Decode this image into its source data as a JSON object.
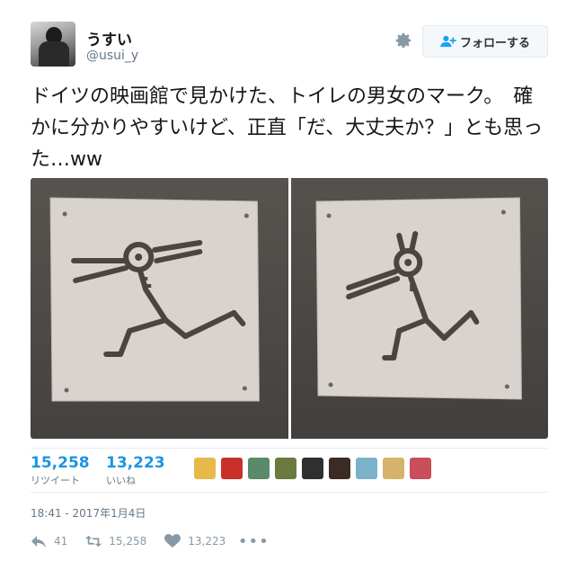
{
  "user": {
    "display_name": "うすい",
    "screen_name": "@usui_y"
  },
  "follow_button": {
    "label": "フォローする"
  },
  "tweet": {
    "text": "ドイツの映画館で見かけた、トイレの男女のマーク。　確かに分かりやすいけど、正直「だ、大丈夫か？」とも思った…ww"
  },
  "photos": [
    {
      "subject": "men's toilet sign"
    },
    {
      "subject": "women's toilet sign"
    }
  ],
  "stats": {
    "retweets": {
      "count": "15,258",
      "label": "リツイート"
    },
    "likes": {
      "count": "13,223",
      "label": "いいね"
    }
  },
  "likers": [
    {
      "color": "#e8b84a"
    },
    {
      "color": "#c8302a"
    },
    {
      "color": "#5a8a6a"
    },
    {
      "color": "#6b7a3f"
    },
    {
      "color": "#2f2f2f"
    },
    {
      "color": "#3a2b25"
    },
    {
      "color": "#7bb1c9"
    },
    {
      "color": "#d6b36a"
    },
    {
      "color": "#c94d5b"
    }
  ],
  "timestamp": "18:41 - 2017年1月4日",
  "actions": {
    "reply": {
      "count": "41",
      "icon": "reply-icon"
    },
    "retweet": {
      "count": "15,258",
      "icon": "retweet-icon"
    },
    "like": {
      "count": "13,223",
      "icon": "heart-icon"
    },
    "more": {
      "icon": "more-icon"
    }
  },
  "colors": {
    "accent": "#1da1f2",
    "link": "#1b95e0",
    "muted": "#657786",
    "icon": "#8899a6"
  }
}
